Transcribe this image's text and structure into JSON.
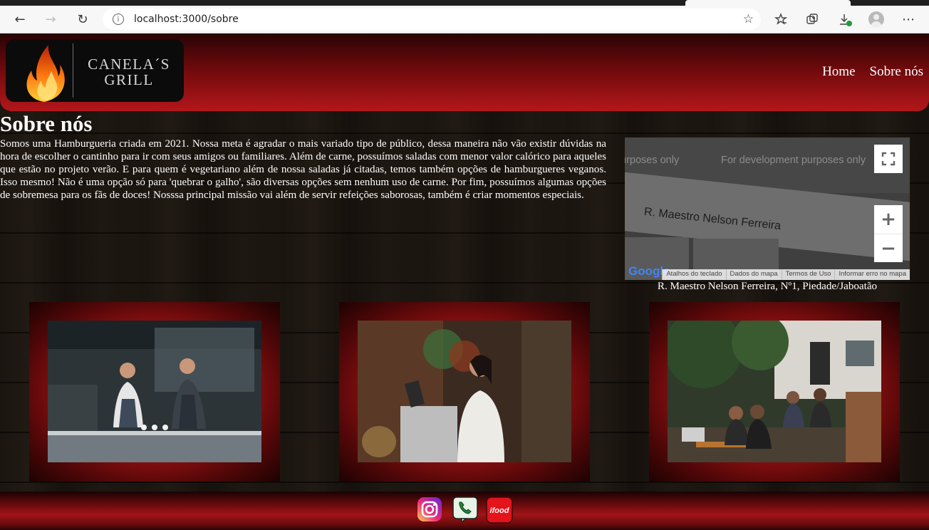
{
  "browser": {
    "url": "localhost:3000/sobre",
    "back_icon": "←",
    "forward_icon": "→",
    "reload_icon": "↻",
    "info_icon": "i",
    "star_icon": "☆",
    "menu_icon": "⋯"
  },
  "header": {
    "logo_line1": "CANELA´S",
    "logo_line2": "GRILL",
    "nav": [
      "Home",
      "Sobre nós"
    ]
  },
  "about": {
    "title": "Sobre nós",
    "text": "Somos uma Hamburgueria criada em 2021. Nossa meta é agradar o mais variado tipo de público, dessa maneira não vão existir dúvidas na hora de escolher o cantinho para ir com seus amigos ou familiares. Além de carne, possuímos saladas com menor valor calórico para aqueles que estão no projeto verão. E para quem é vegetariano além de nossa saladas já citadas, temos também opções de hamburgueres veganos. Isso mesmo! Não é uma opção só para 'quebrar o galho', são diversas opções sem nenhum uso de carne. Por fim, possuímos algumas opções de sobremesa para os fãs de doces! Nosssa principal missão vai além de servir refeições saborosas, também é criar momentos especiais."
  },
  "map": {
    "watermark": "For development purposes only",
    "watermark_partial": "urposes only",
    "street_label": "R. Maestro Nelson Ferreira",
    "google_logo": "Google",
    "footer_links": [
      "Atalhos do teclado",
      "Dados do mapa",
      "Termos de Uso",
      "Informar erro no mapa"
    ],
    "fullscreen_icon": "⛶",
    "zoom_in_icon": "+",
    "zoom_out_icon": "−",
    "address": "R. Maestro Nelson Ferreira, Nº1, Piedade/Jaboatão"
  },
  "gallery": [
    {
      "alt": "kitchen-chefs-photo"
    },
    {
      "alt": "cashier-photo"
    },
    {
      "alt": "outdoor-cafe-photo"
    }
  ],
  "footer": {
    "icons": [
      "instagram-icon",
      "whatsapp-icon",
      "ifood-icon"
    ],
    "ifood_label": "ifood"
  },
  "colors": {
    "header_red": "#b3171a",
    "page_bg": "#1b1510",
    "text": "#ffffff"
  }
}
